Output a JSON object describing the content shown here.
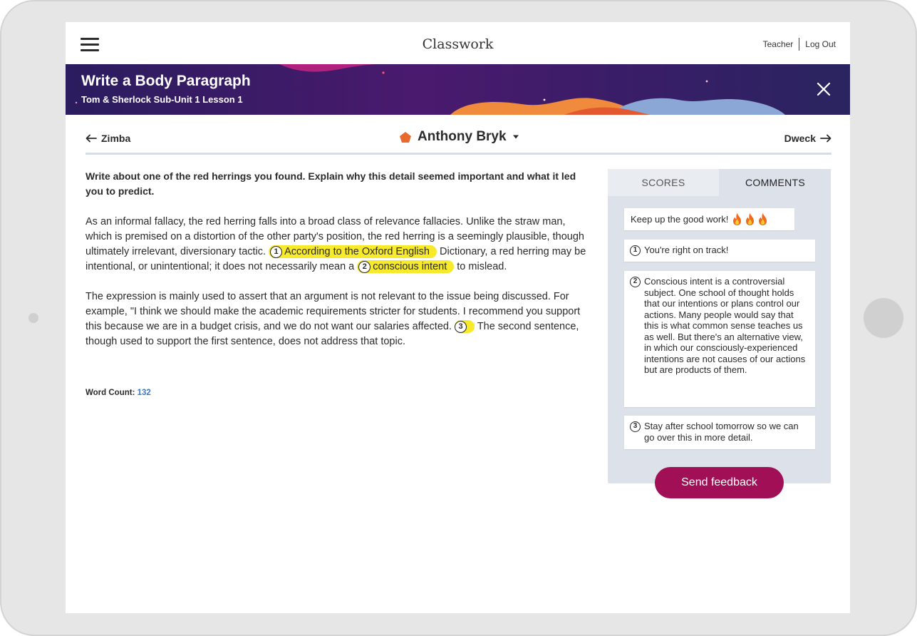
{
  "app": {
    "title": "Classwork"
  },
  "header": {
    "teacher_label": "Teacher",
    "logout_label": "Log Out"
  },
  "banner": {
    "title": "Write a Body Paragraph",
    "subtitle": "Tom & Sherlock Sub-Unit 1 Lesson 1"
  },
  "student_nav": {
    "prev_label": "Zimba",
    "current_student": "Anthony Bryk",
    "next_label": "Dweck"
  },
  "assignment": {
    "prompt": "Write about one of the red herrings you found. Explain why this detail seemed important and what it led you to predict.",
    "p1_a": "As an informal fallacy, the red herring falls into a broad class of relevance fallacies. Unlike the straw man, which is premised on a distortion of the other party's position, the red herring is a seemingly plausible, though ultimately irrelevant, diversionary tactic. ",
    "p1_hl1_num": "1",
    "p1_hl1": "According to the Oxford English",
    "p1_b": " Dictionary, a red herring may be intentional, or unintentional; it does not necessarily mean a ",
    "p1_hl2_num": "2",
    "p1_hl2": "conscious intent",
    "p1_c": " to mislead.",
    "p2_a": "The expression is mainly used to assert that an argument is not relevant to the issue being discussed. For example, \"I think we should make the academic requirements stricter for students. I recommend you support this because we are in a budget crisis, and we do not want our salaries affected. ",
    "p2_hl3_num": "3",
    "p2_b": " The second sentence, though used to support the first sentence, does not address that topic.",
    "word_count_label": "Word Count:",
    "word_count": "132"
  },
  "feedback_panel": {
    "tabs": [
      {
        "label": "SCORES",
        "active": false
      },
      {
        "label": "COMMENTS",
        "active": true
      }
    ],
    "general_comment": "Keep up the good work!",
    "comments": [
      {
        "num": "1",
        "text": "You're right on track!"
      },
      {
        "num": "2",
        "text": "Conscious intent is a controversial subject. One school of thought holds that our intentions or plans control our actions. Many people would say that this is what common sense teaches us as well. But there's an alternative view, in which our consciously-experienced intentions are not causes of our actions but are products of them."
      },
      {
        "num": "3",
        "text": "Stay after school tomorrow so we can go over this in more detail."
      }
    ],
    "send_button": "Send feedback"
  },
  "colors": {
    "banner_bg": "#2f1f63",
    "highlight": "#f7ea2b",
    "send_button": "#a11057",
    "student_icon": "#e8692d",
    "word_count_value": "#3d78c4"
  },
  "icons": {
    "menu": "hamburger-icon",
    "close": "close-icon",
    "prev": "arrow-left-icon",
    "next": "arrow-right-icon",
    "student": "pentagon-icon",
    "dropdown": "caret-down-icon",
    "emoji": "fire-icon"
  }
}
